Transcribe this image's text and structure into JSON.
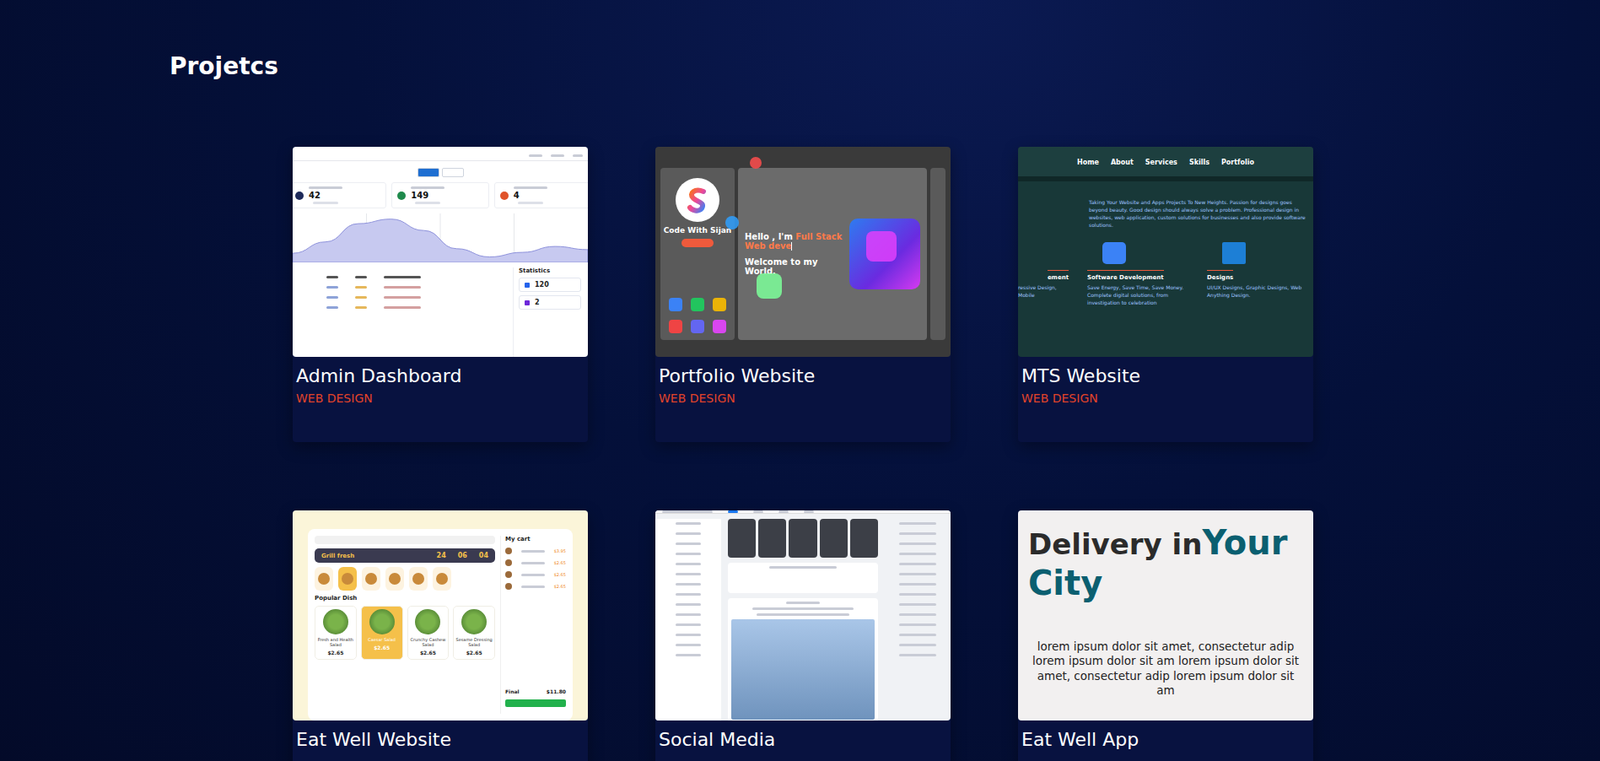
{
  "section": {
    "title": "Projetcs"
  },
  "projects": [
    {
      "title": "Admin Dashboard",
      "tag": "WEB DESIGN",
      "kind": "admin",
      "preview": {
        "stats": [
          {
            "value": "42",
            "color": "#1e2a5a"
          },
          {
            "value": "149",
            "color": "#1f8a4c"
          },
          {
            "value": "4",
            "color": "#e0532a"
          }
        ],
        "chart": [
          20,
          45,
          85,
          95,
          70,
          30,
          12,
          22,
          35,
          28
        ],
        "panel": {
          "title": "Statistics",
          "items": [
            "120",
            "2"
          ]
        }
      }
    },
    {
      "title": "Portfolio Website",
      "tag": "WEB DESIGN",
      "kind": "portfolio",
      "preview": {
        "name": "Code With Sijan",
        "greeting": "Hello , I'm ",
        "role": "Full Stack Web deve",
        "welcome": "Welcome to my World.",
        "apps": [
          {
            "color": "#3b82f6"
          },
          {
            "color": "#22c55e"
          },
          {
            "color": "#eab308"
          },
          {
            "color": "#ef4444"
          },
          {
            "color": "#6366f1"
          },
          {
            "color": "#d946ef"
          }
        ]
      }
    },
    {
      "title": "MTS Website",
      "tag": "WEB DESIGN",
      "kind": "mts",
      "preview": {
        "nav": [
          "Home",
          "About",
          "Services",
          "Skills",
          "Portfolio"
        ],
        "intro": "Taking Your Website and Apps Projects To New Heights. Passion for designs goes beyond beauty. Good design should always solve a problem. Professional design in websites, web application, custom solutions for businesses and also provide software solutions.",
        "features": [
          {
            "title": "ement",
            "text": "ressive Design, Mobile",
            "color": "#2e9be8"
          },
          {
            "title": "Software Development",
            "text": "Save Energy, Save Time, Save Money. Complete digital solutions, from investigation to celebration",
            "color": "#3b82f6"
          },
          {
            "title": "Designs",
            "text": "UI/UX Designs, Graphic Designs, Web Anything Design.",
            "color": "#1d7fd6"
          }
        ]
      }
    },
    {
      "title": "Eat Well Website",
      "kind": "food",
      "preview": {
        "banner": "Grill fresh",
        "bannerStats": [
          "24",
          "06",
          "04"
        ],
        "section": "Popular Dish",
        "categories": [
          {
            "selected": false
          },
          {
            "selected": true
          },
          {
            "selected": false
          },
          {
            "selected": false
          },
          {
            "selected": false
          },
          {
            "selected": false
          }
        ],
        "dishes": [
          {
            "name": "Fresh and Health Salad",
            "price": "$2.65",
            "selected": false
          },
          {
            "name": "Caesar Salad",
            "price": "$2.65",
            "selected": true
          },
          {
            "name": "Crunchy Cashew Salad",
            "price": "$2.65",
            "selected": false
          },
          {
            "name": "Sesame Dressing Salad",
            "price": "$2.65",
            "selected": false
          }
        ],
        "cart": {
          "title": "My cart",
          "items": [
            "$3.95",
            "$2.65",
            "$2.65",
            "$2.65"
          ],
          "totalLabel": "Final",
          "total": "$11.80"
        }
      }
    },
    {
      "title": "Social Media",
      "kind": "social",
      "preview": {}
    },
    {
      "title": "Eat Well App",
      "kind": "delivery",
      "preview": {
        "heading": "Delivery in",
        "highlight": "Your City",
        "body": "lorem ipsum dolor sit amet, consectetur adip lorem ipsum dolor sit am lorem ipsum dolor sit amet, consectetur adip lorem ipsum dolor sit am"
      }
    }
  ]
}
